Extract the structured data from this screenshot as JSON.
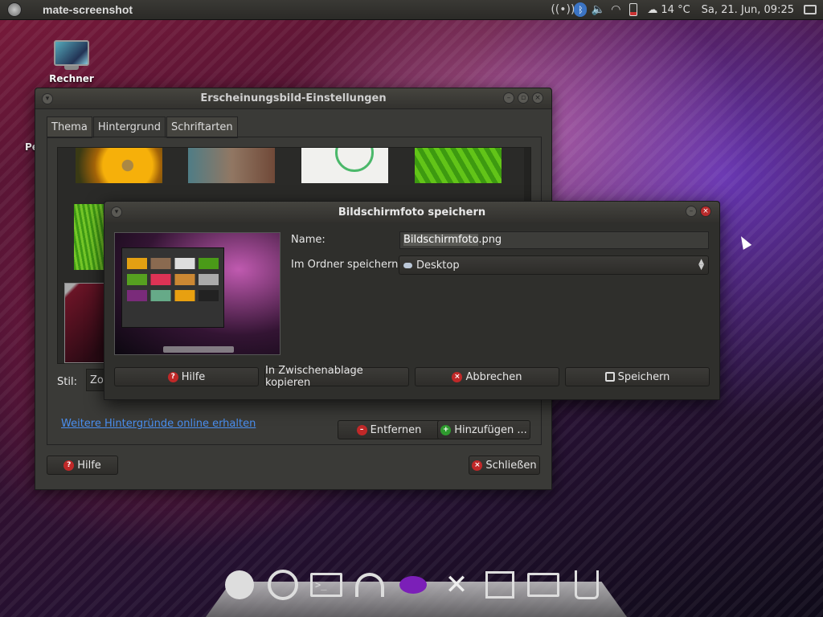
{
  "top_panel": {
    "app_title": "mate-screenshot",
    "temperature": "14 °C",
    "clock": "Sa, 21. Jun, 09:25"
  },
  "desktop": {
    "computer_icon_label": "Rechner",
    "partial_label": "Pe"
  },
  "appearance_window": {
    "title": "Erscheinungsbild-Einstellungen",
    "tabs": [
      "Thema",
      "Hintergrund",
      "Schriftarten"
    ],
    "active_tab": "Hintergrund",
    "style_label": "Stil:",
    "style_value": "Zoo",
    "online_link": "Weitere Hintergründe online erhalten",
    "remove_button": "Entfernen",
    "add_button": "Hinzufügen ...",
    "help_button": "Hilfe",
    "close_button": "Schließen"
  },
  "screenshot_dialog": {
    "title": "Bildschirmfoto speichern",
    "name_label": "Name:",
    "name_selected": "Bildschirmfoto",
    "name_ext": ".png",
    "folder_label": "Im Ordner speichern:",
    "folder_value": "Desktop",
    "buttons": {
      "help": "Hilfe",
      "copy": "In Zwischenablage kopieren",
      "cancel": "Abbrechen",
      "save": "Speichern"
    }
  },
  "colors": {
    "link": "#4a8ff0",
    "danger": "#c02828",
    "success": "#2e9a2e",
    "accent_purple": "#7b1fb8"
  }
}
